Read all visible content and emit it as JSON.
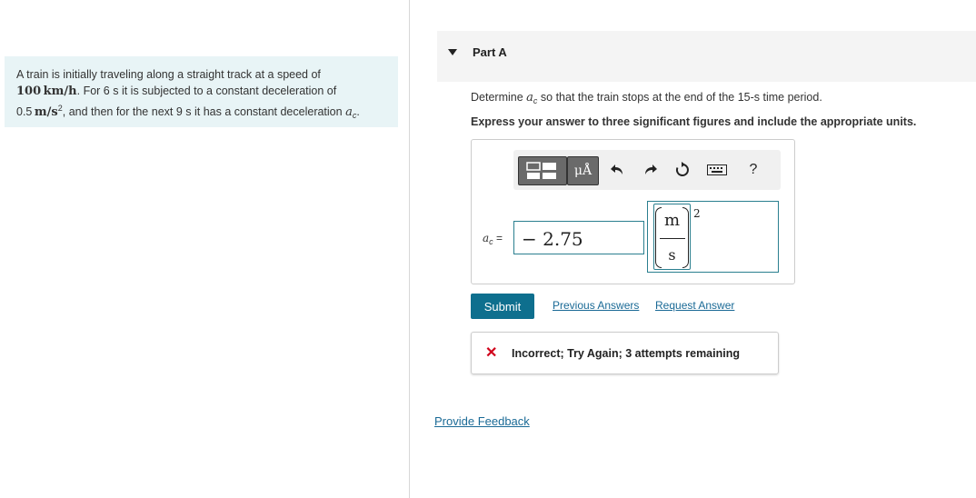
{
  "problem": {
    "line1": "A train is initially traveling along a straight track at a speed of",
    "speed_value": "100",
    "speed_unit": "km/h",
    "line2_rest": ". For 6 s it is subjected to a constant deceleration of",
    "decel_value": "0.5",
    "decel_unit": "m/s",
    "decel_exp": "2",
    "line3_rest": ", and then for the next 9 s it has a constant deceleration",
    "var": "a",
    "var_sub": "c",
    "period": "."
  },
  "part": {
    "label": "Part A"
  },
  "question": {
    "prefix": "Determine",
    "var": "a",
    "var_sub": "c",
    "suffix": "so that the train stops at the end of the 15-s time period."
  },
  "instructions": "Express your answer to three significant figures and include the appropriate units.",
  "toolbar": {
    "units_label": "μÅ",
    "icons": [
      "templates-icon",
      "units-icon",
      "undo-icon",
      "redo-icon",
      "reset-icon",
      "keyboard-icon",
      "help-icon"
    ],
    "help_label": "?"
  },
  "answer": {
    "var_label": "a",
    "var_sub": "c",
    "equals": "=",
    "value": "− 2.75",
    "unit_num": "m",
    "unit_den": "s",
    "unit_exp": "2"
  },
  "actions": {
    "submit": "Submit",
    "previous": "Previous Answers",
    "request": "Request Answer"
  },
  "feedback": {
    "text": "Incorrect; Try Again; 3 attempts remaining",
    "status_color": "#d0021b"
  },
  "provide_feedback": "Provide Feedback"
}
